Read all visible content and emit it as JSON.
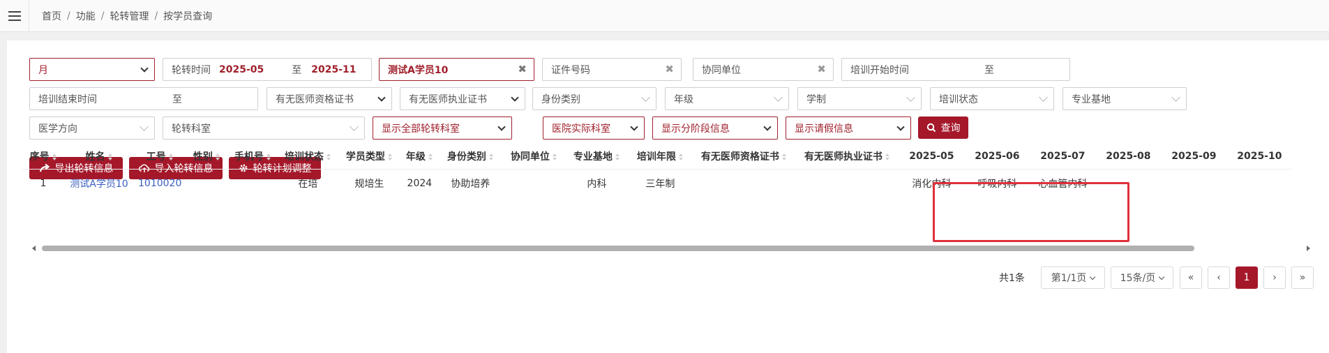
{
  "breadcrumb": [
    "首页",
    "功能",
    "轮转管理",
    "按学员查询"
  ],
  "filters": {
    "period_select": "月",
    "rotation_time_label": "轮转时间",
    "rotation_from": "2025-05",
    "rotation_to_sep": "至",
    "rotation_to": "2025-11",
    "student_name": "测试A学员10",
    "id_number_placeholder": "证件号码",
    "partner_unit_placeholder": "协同单位",
    "train_start_placeholder": "培训开始时间",
    "train_start_sep": "至",
    "train_end_placeholder": "培训结束时间",
    "train_end_sep": "至",
    "doctor_qual_cert": "有无医师资格证书",
    "doctor_practice_cert": "有无医师执业证书",
    "identity_type": "身份类别",
    "grade": "年级",
    "program_length": "学制",
    "training_status": "培训状态",
    "specialty_base": "专业基地",
    "medical_direction": "医学方向",
    "rotation_dept": "轮转科室",
    "show_all_depts": "显示全部轮转科室",
    "hospital_actual_dept": "医院实际科室",
    "show_stage_info": "显示分阶段信息",
    "show_leave_info": "显示请假信息",
    "search_button": "查询"
  },
  "actions": {
    "export": "导出轮转信息",
    "import": "导入轮转信息",
    "plan_adjust": "轮转计划调整"
  },
  "table": {
    "columns": [
      "序号",
      "姓名",
      "工号",
      "性别",
      "手机号",
      "培训状态",
      "学员类型",
      "年级",
      "身份类别",
      "协同单位",
      "专业基地",
      "培训年限",
      "有无医师资格证书",
      "有无医师执业证书",
      "2025-05",
      "2025-06",
      "2025-07",
      "2025-08",
      "2025-09",
      "2025-10"
    ],
    "rows": [
      [
        "1",
        "测试A学员10",
        "1010020",
        "",
        "",
        "在培",
        "规培生",
        "2024",
        "协助培养",
        "",
        "内科",
        "三年制",
        "",
        "",
        "消化内科",
        "呼吸内科",
        "心血管内科",
        "",
        "",
        ""
      ]
    ]
  },
  "pagination": {
    "total": "共1条",
    "page_select": "第1/1页",
    "page_size_select": "15条/页",
    "first": "«",
    "prev": "‹",
    "current": "1",
    "next": "›",
    "last": "»"
  },
  "colors": {
    "accent": "#a4182a",
    "highlight_border": "#e0303a",
    "link": "#3a5ec0"
  }
}
